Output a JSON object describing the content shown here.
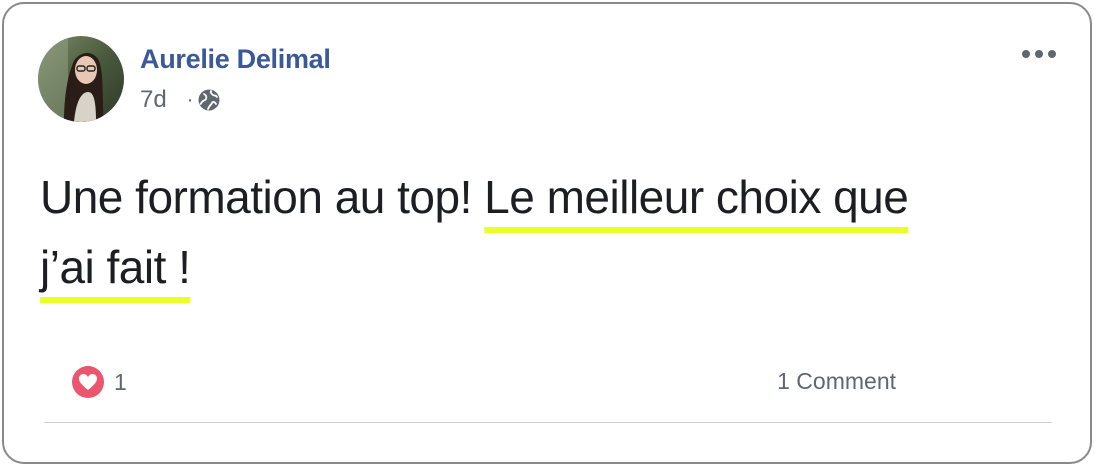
{
  "post": {
    "author": "Aurelie Delimal",
    "time": "7d",
    "separator": "·",
    "privacy_icon": "globe-icon",
    "more_icon": "more-options-icon",
    "text_plain": "Une formation au top! ",
    "text_highlighted_1": "Le meilleur choix que",
    "text_highlighted_2": "j’ai fait !",
    "highlight_color": "#eaff2a",
    "author_color": "#3b5998"
  },
  "footer": {
    "reaction_icon": "heart-icon",
    "reaction_count": "1",
    "comments_label": "1 Comment"
  }
}
